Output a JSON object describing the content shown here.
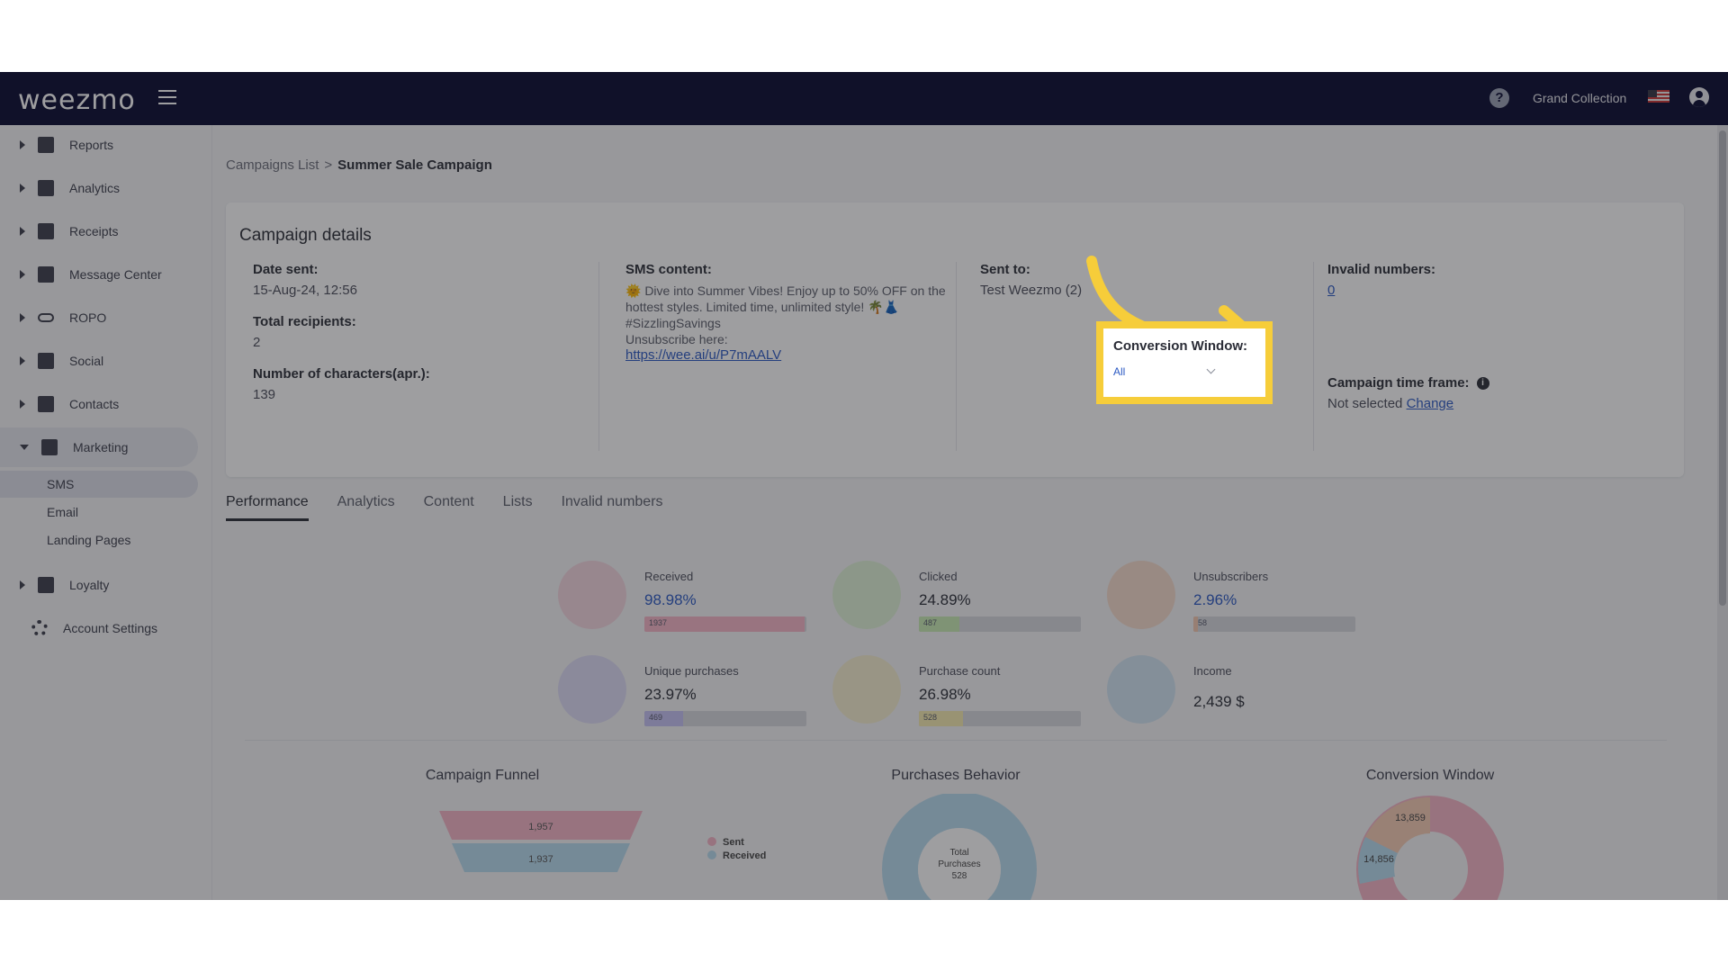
{
  "header": {
    "logo": "weezmo",
    "account_name": "Grand Collection",
    "help_label": "?"
  },
  "sidebar": {
    "items": [
      {
        "label": "Reports",
        "icon": "dashboard-icon"
      },
      {
        "label": "Analytics",
        "icon": "analytics-icon"
      },
      {
        "label": "Receipts",
        "icon": "receipt-icon"
      },
      {
        "label": "Message Center",
        "icon": "message-icon"
      },
      {
        "label": "ROPO",
        "icon": "infinity-icon"
      },
      {
        "label": "Social",
        "icon": "people-icon"
      },
      {
        "label": "Contacts",
        "icon": "contacts-icon"
      },
      {
        "label": "Marketing",
        "icon": "megaphone-icon"
      },
      {
        "label": "Loyalty",
        "icon": "tag-icon"
      }
    ],
    "marketing_sub": [
      "SMS",
      "Email",
      "Landing Pages"
    ],
    "settings_label": "Account Settings"
  },
  "breadcrumb": {
    "parent": "Campaigns List",
    "sep": ">",
    "current": "Summer Sale Campaign"
  },
  "campaign": {
    "title": "Campaign details",
    "date_sent_label": "Date sent:",
    "date_sent": "15-Aug-24, 12:56",
    "recipients_label": "Total recipients:",
    "recipients": "2",
    "chars_label": "Number of characters(apr.):",
    "chars": "139",
    "sms_label": "SMS content:",
    "sms_text": "🌞 Dive into Summer Vibes! Enjoy up to 50% OFF on the hottest styles. Limited time, unlimited style! 🌴👗 #SizzlingSavings",
    "unsubscribe_text": "Unsubscribe here:",
    "unsubscribe_link": "https://wee.ai/u/P7mAALV",
    "sent_to_label": "Sent to:",
    "sent_to": "Test Weezmo (2)",
    "invalid_label": "Invalid numbers:",
    "invalid_value": "0",
    "cw_label": "Conversion Window:",
    "cw_value": "All",
    "timeframe_label": "Campaign time frame:",
    "timeframe_value": "Not selected",
    "timeframe_change": "Change",
    "info": "i"
  },
  "tabs": [
    "Performance",
    "Analytics",
    "Content",
    "Lists",
    "Invalid numbers"
  ],
  "kpis": [
    {
      "name": "Received",
      "value": "98.98%",
      "bar": "1937",
      "fill": 0.99,
      "color": "#f7b6c7",
      "bg": "#f4d6e0"
    },
    {
      "name": "Clicked",
      "value": "24.89%",
      "bar": "487",
      "fill": 0.25,
      "color": "#c9ecb4",
      "bg": "#dff2d6"
    },
    {
      "name": "Unsubscribers",
      "value": "2.96%",
      "bar": "58",
      "fill": 0.03,
      "color": "#f5c9b0",
      "bg": "#f7dccd"
    },
    {
      "name": "Unique purchases",
      "value": "23.97%",
      "bar": "469",
      "fill": 0.24,
      "color": "#c6c2f4",
      "bg": "#dedcf6"
    },
    {
      "name": "Purchase count",
      "value": "26.98%",
      "bar": "528",
      "fill": 0.27,
      "color": "#f6ecb0",
      "bg": "#f6f0d0"
    },
    {
      "name": "Income",
      "value": "2,439 $",
      "bg": "#d2e4f3"
    }
  ],
  "charts": {
    "funnel_title": "Campaign Funnel",
    "behavior_title": "Purchases Behavior",
    "cw_title": "Conversion Window",
    "funnel_values": [
      "1,957",
      "1,937"
    ],
    "legend": [
      "Sent",
      "Received"
    ],
    "donut_center": [
      "Total",
      "Purchases",
      "528"
    ],
    "cw_values": [
      "13,859",
      "14,856"
    ]
  },
  "colors": {
    "accent": "#2b59c3",
    "highlight": "#f6cd3a",
    "topbar": "#06082f"
  }
}
